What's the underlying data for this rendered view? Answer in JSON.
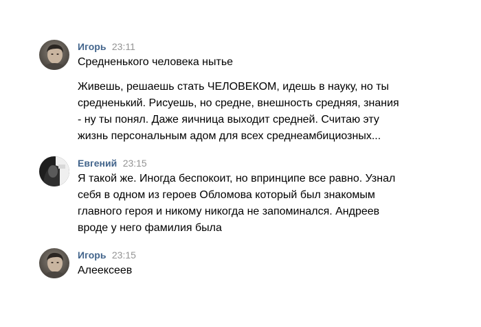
{
  "messages": [
    {
      "author": "Игорь",
      "time": "23:11",
      "avatar_icon": "user-avatar-igor",
      "paragraphs": [
        "Средненького человека нытье",
        "Живешь, решаешь стать ЧЕЛОВЕКОМ, идешь в науку, но ты средненький. Рисуешь, но средне, внешность средняя, знания - ну ты понял. Даже яичница выходит средней. Считаю эту жизнь персональным адом для всех среднеамбициозных..."
      ]
    },
    {
      "author": "Евгений",
      "time": "23:15",
      "avatar_icon": "user-avatar-evgeniy",
      "paragraphs": [
        "Я такой же. Иногда беспокоит, но впринципе все равно. Узнал себя в одном из героев Обломова который был знакомым главного героя и никому никогда не запоминался. Андреев вроде у него фамилия была"
      ]
    },
    {
      "author": "Игорь",
      "time": "23:15",
      "avatar_icon": "user-avatar-igor",
      "paragraphs": [
        "Алеексеев"
      ]
    }
  ],
  "colors": {
    "author": "#42648b",
    "time": "#939393",
    "text": "#000000",
    "background": "#ffffff"
  }
}
